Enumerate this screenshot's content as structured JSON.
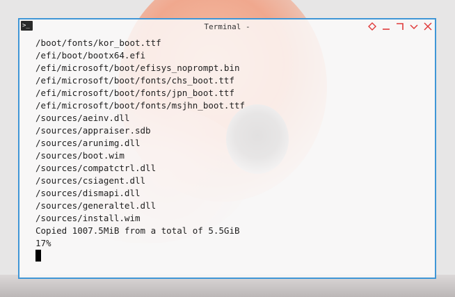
{
  "window": {
    "title": "Terminal -",
    "icon": "terminal-prompt-icon",
    "border_color": "#3f96d6",
    "control_color": "#e03a3a",
    "controls": [
      "keep-above-icon",
      "minimize-icon",
      "maximize-icon",
      "shade-icon",
      "close-icon"
    ]
  },
  "terminal": {
    "prompt_glyph": ">_",
    "lines": [
      "/boot/fonts/kor_boot.ttf",
      "/efi/boot/bootx64.efi",
      "/efi/microsoft/boot/efisys_noprompt.bin",
      "/efi/microsoft/boot/fonts/chs_boot.ttf",
      "/efi/microsoft/boot/fonts/jpn_boot.ttf",
      "/efi/microsoft/boot/fonts/msjhn_boot.ttf",
      "/sources/aeinv.dll",
      "/sources/appraiser.sdb",
      "/sources/arunimg.dll",
      "/sources/boot.wim",
      "/sources/compatctrl.dll",
      "/sources/csiagent.dll",
      "/sources/dismapi.dll",
      "/sources/generaltel.dll",
      "/sources/install.wim",
      "Copied 1007.5MiB from a total of 5.5GiB",
      "17%"
    ]
  }
}
